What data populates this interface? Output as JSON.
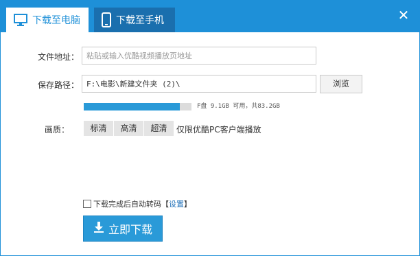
{
  "tabs": [
    {
      "label": "下载至电脑",
      "icon": "monitor-icon"
    },
    {
      "label": "下载至手机",
      "icon": "phone-icon"
    }
  ],
  "close_icon": "close-icon",
  "file_address": {
    "label": "文件地址：",
    "placeholder": "粘贴或输入优酷视频播放页地址",
    "value": ""
  },
  "save_path": {
    "label": "保存路径：",
    "value": "F:\\电影\\新建文件夹 (2)\\",
    "browse_label": "浏览"
  },
  "disk": {
    "used_fraction": 0.89,
    "text": "F盘 9.1GB 可用，共83.2GB"
  },
  "quality": {
    "label": "画质：",
    "options": [
      "标清",
      "高清",
      "超清"
    ],
    "selected": "超清",
    "note": "仅限优酷PC客户端播放"
  },
  "auto_transcode": {
    "checked": false,
    "label": "下载完成后自动转码",
    "bracket_open": "【",
    "settings_label": "设置",
    "bracket_close": "】"
  },
  "download_button": {
    "label": "立即下载",
    "icon": "download-arrow-icon"
  },
  "colors": {
    "accent": "#1e90d8",
    "tab_inactive": "#1a6fae",
    "button": "#2a9ad8",
    "link": "#1e6fb8"
  }
}
